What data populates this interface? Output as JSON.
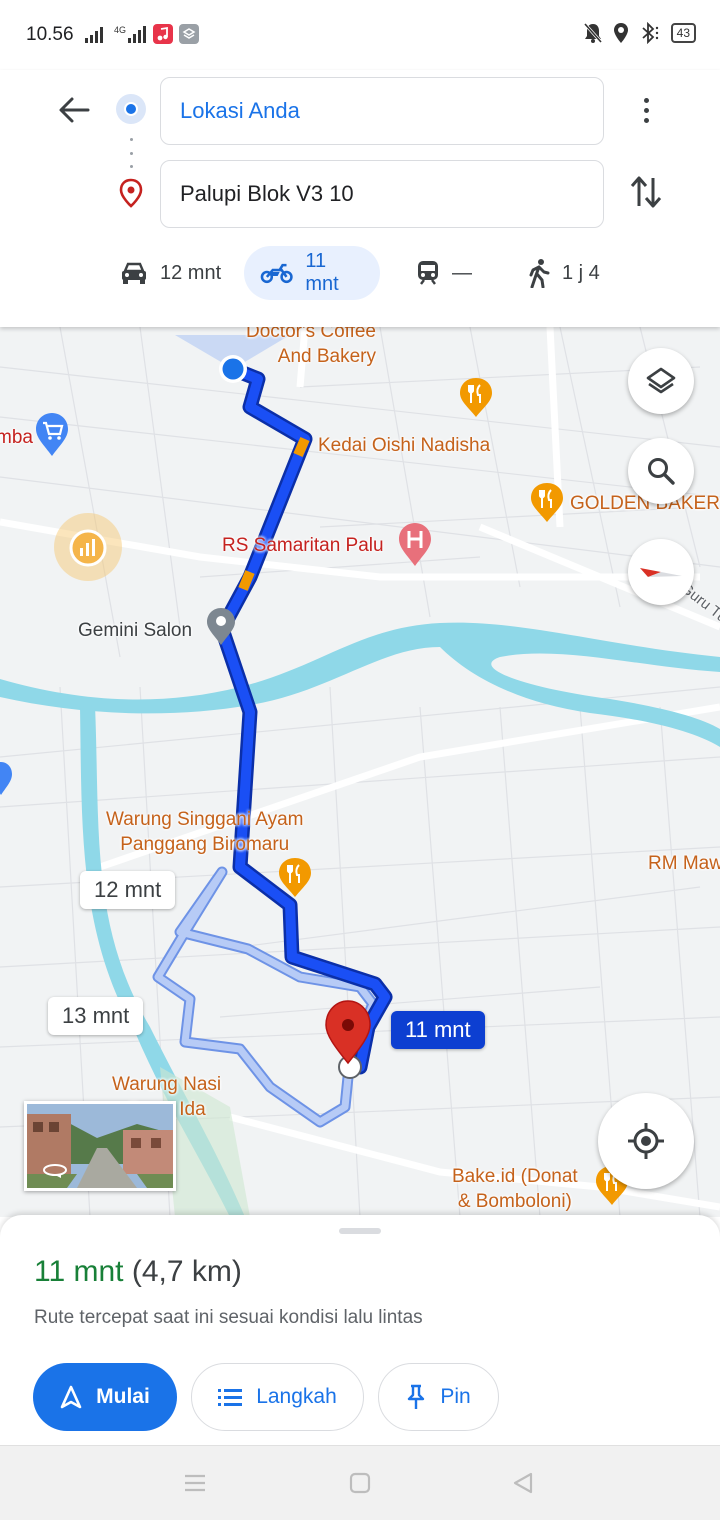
{
  "status_bar": {
    "time": "10.56",
    "network": "4G",
    "battery": "43",
    "icons": [
      "signal-icon",
      "signal-4g-icon",
      "music-app-icon",
      "app-notification-icon",
      "mute-icon",
      "location-icon",
      "bluetooth-icon",
      "battery-icon"
    ]
  },
  "directions": {
    "origin": "Lokasi Anda",
    "destination": "Palupi Blok V3 10",
    "icons": [
      "back-arrow-icon",
      "origin-dot-icon",
      "destination-pin-icon",
      "more-vert-icon",
      "swap-icon"
    ]
  },
  "modes": [
    {
      "id": "car",
      "label": "12 mnt",
      "icon": "car-icon",
      "selected": false
    },
    {
      "id": "motorcycle",
      "label": "11 mnt",
      "icon": "motorcycle-icon",
      "selected": true
    },
    {
      "id": "transit",
      "label": "—",
      "icon": "transit-icon",
      "selected": false
    },
    {
      "id": "walk",
      "label": "1 j 4",
      "icon": "walk-icon",
      "selected": false
    }
  ],
  "map": {
    "labels": {
      "doctors_coffee": "Doctor's Coffee\nAnd Bakery",
      "kedai_oishi": "Kedai Oishi Nadisha",
      "golden_baker": "GOLDEN BAKER",
      "rs_samaritan": "RS Samaritan Palu",
      "gemini_salon": "Gemini Salon",
      "guru_tua": "Guru Tua",
      "warung_singgani": "Warung Singgani Ayam\nPanggang Biromaru",
      "rm_maw": "RM Maw",
      "warung_nasi": "Warung Nasi\nTante Ida",
      "bake_id": "Bake.id (Donat\n& Bomboloni)",
      "mba": "mba"
    },
    "route_times": {
      "selected": "11 mnt",
      "alt1": "12 mnt",
      "alt2": "13 mnt"
    },
    "controls": [
      "layers-icon",
      "search-icon",
      "compass-icon",
      "my-location-icon"
    ],
    "colors": {
      "route_main": "#0d3fd1",
      "route_alt": "#a8c3f5",
      "river": "#8fd8e8",
      "traffic": "#f29900"
    }
  },
  "sheet": {
    "duration": "11 mnt",
    "distance": "(4,7 km)",
    "subtitle": "Rute tercepat saat ini sesuai kondisi lalu lintas",
    "buttons": {
      "start": "Mulai",
      "steps": "Langkah",
      "pin": "Pin"
    }
  },
  "navbar": [
    "menu-icon",
    "home-icon",
    "back-icon"
  ]
}
